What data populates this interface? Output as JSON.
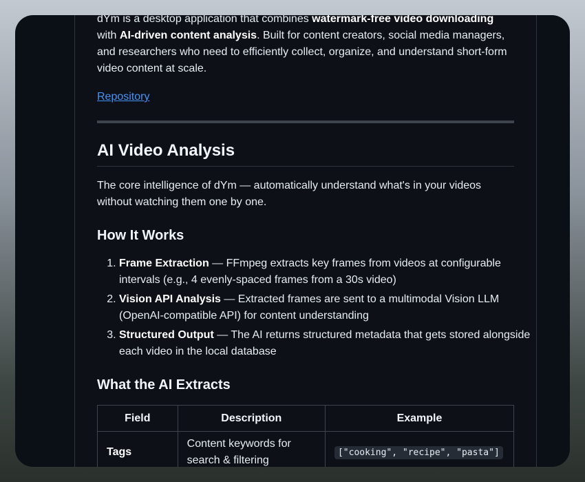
{
  "intro": {
    "part1": "dYm is a desktop application that combines ",
    "bold1": "watermark-free video downloading",
    "part2": " with ",
    "bold2": "AI-driven content analysis",
    "part3": ". Built for content creators, social media managers, and researchers who need to efficiently collect, organize, and understand short-form video content at scale."
  },
  "repository_link": "Repository",
  "section_title": "AI Video Analysis",
  "section_desc": "The core intelligence of dYm — automatically understand what's in your videos without watching them one by one.",
  "how_title": "How It Works",
  "steps": [
    {
      "title": "Frame Extraction",
      "text": " — FFmpeg extracts key frames from videos at configurable intervals (e.g., 4 evenly-spaced frames from a 30s video)"
    },
    {
      "title": "Vision API Analysis",
      "text": " — Extracted frames are sent to a multimodal Vision LLM (OpenAI-compatible API) for content understanding"
    },
    {
      "title": "Structured Output",
      "text": " — The AI returns structured metadata that gets stored alongside each video in the local database"
    }
  ],
  "extracts_title": "What the AI Extracts",
  "table": {
    "headers": [
      "Field",
      "Description",
      "Example"
    ],
    "rows": [
      {
        "field": "Tags",
        "description": "Content keywords for search & filtering",
        "example": "[\"cooking\", \"recipe\", \"pasta\"]"
      }
    ]
  }
}
